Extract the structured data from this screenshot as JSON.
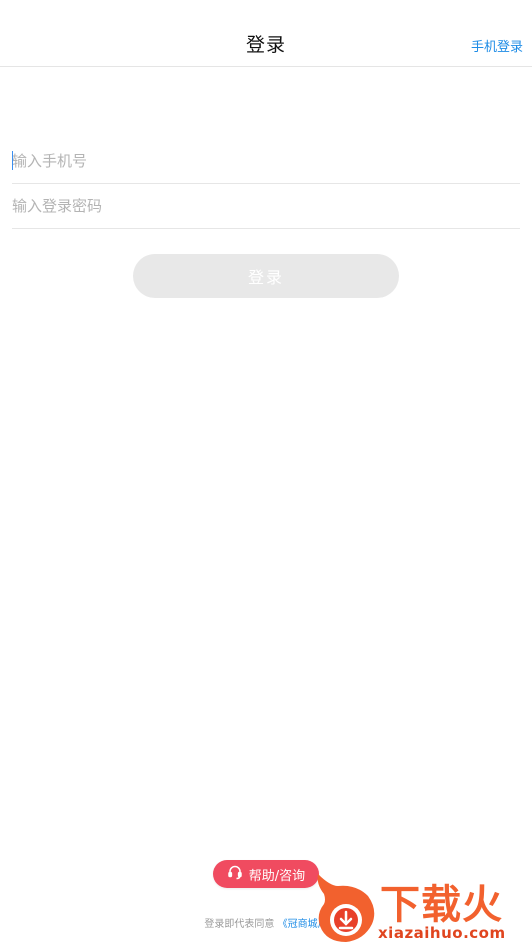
{
  "header": {
    "title": "登录",
    "right_link": "手机登录"
  },
  "form": {
    "phone_placeholder": "输入手机号",
    "password_placeholder": "输入登录密码",
    "submit_label": "登录"
  },
  "help": {
    "label": "帮助/咨询",
    "icon": "headset-icon"
  },
  "agreement": {
    "prefix": "登录即代表同意",
    "link_text": "《冠商城用"
  },
  "watermark": {
    "brand": "下载火",
    "domain": "xiazaihuo.com"
  },
  "colors": {
    "accent_blue": "#1e8ce6",
    "help_red": "#f04b60",
    "button_disabled": "#e8e8e8"
  }
}
